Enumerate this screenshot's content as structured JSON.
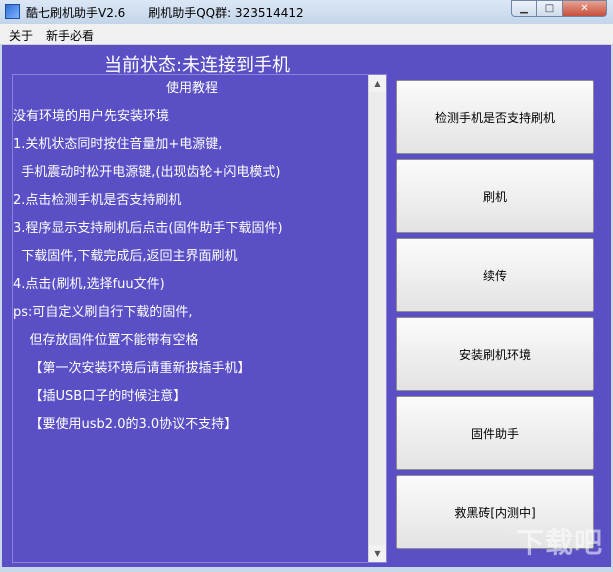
{
  "window": {
    "title": "酷七刷机助手V2.6",
    "title_extra": "刷机助手QQ群: 323514412"
  },
  "menu": [
    "关于",
    "新手必看"
  ],
  "status": "当前状态:未连接到手机",
  "tutorial": {
    "title": "使用教程",
    "lines": [
      "没有环境的用户先安装环境",
      "1.关机状态同时按住音量加+电源键,",
      "  手机震动时松开电源键,(出现齿轮+闪电模式)",
      "2.点击检测手机是否支持刷机",
      "3.程序显示支持刷机后点击(固件助手下载固件)",
      "  下载固件,下载完成后,返回主界面刷机",
      "4.点击(刷机,选择fuu文件)",
      "ps:可自定义刷自行下载的固件,",
      "    但存放固件位置不能带有空格",
      "    【第一次安装环境后请重新拔插手机】",
      "    【插USB口子的时候注意】",
      "    【要使用usb2.0的3.0协议不支持】"
    ]
  },
  "buttons": [
    "检测手机是否支持刷机",
    "刷机",
    "续传",
    "安装刷机环境",
    "固件助手",
    "救黑砖[内测中]"
  ],
  "watermark": "下载吧"
}
